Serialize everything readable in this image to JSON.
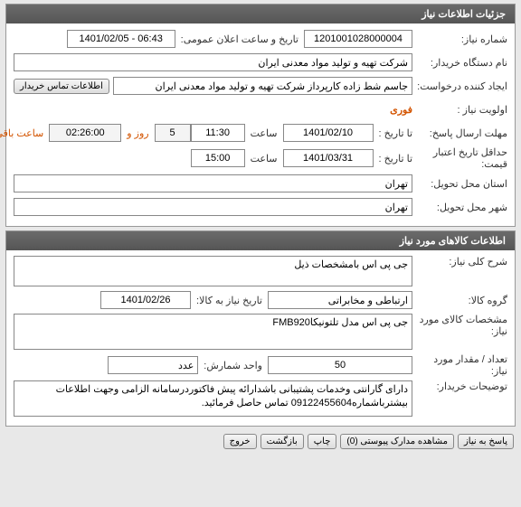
{
  "colors": {
    "accent": "#d35400"
  },
  "panels": {
    "need_header": "جزئیات اطلاعات نیاز",
    "goods_header": "اطلاعات کالاهای مورد نیاز"
  },
  "need": {
    "number_label": "شماره نیاز:",
    "number_value": "1201001028000004",
    "announce_label": "تاریخ و ساعت اعلان عمومی:",
    "announce_value": "1401/02/05 - 06:43",
    "buyer_label": "نام دستگاه خریدار:",
    "buyer_value": "شرکت تهیه و تولید مواد معدنی ایران",
    "creator_label": "ایجاد کننده درخواست:",
    "creator_value": "جاسم شط زاده کارپرداز شرکت تهیه و تولید مواد معدنی ایران",
    "contact_btn": "اطلاعات تماس خریدار",
    "priority_label": "اولویت نیاز :",
    "priority_value": "فوری",
    "reply_deadline_label": "مهلت ارسال پاسخ:",
    "to_date_label": "تا تاریخ :",
    "reply_date": "1401/02/10",
    "time_label": "ساعت",
    "reply_time": "11:30",
    "remain_days": "5",
    "remain_days_label": "روز و",
    "remain_time": "02:26:00",
    "remain_suffix": "ساعت باقی مانده",
    "price_validity_label": "حداقل تاریخ اعتبار قیمت:",
    "price_date": "1401/03/31",
    "price_time": "15:00",
    "delivery_province_label": "استان محل تحویل:",
    "delivery_province": "تهران",
    "delivery_city_label": "شهر محل تحویل:",
    "delivery_city": "تهران"
  },
  "goods": {
    "desc_label": "شرح کلی نیاز:",
    "desc_value": "جی پی اس بامشخصات ذیل",
    "group_label": "گروه کالا:",
    "group_value": "ارتباطی و مخابراتی",
    "need_date_label": "تاریخ نیاز به کالا:",
    "need_date_value": "1401/02/26",
    "spec_label": "مشخصات کالای مورد نیاز:",
    "spec_value": "جی پی اس مدل تلتونیکاFMB920",
    "amount_label": "تعداد / مقدار مورد نیاز:",
    "amount_value": "50",
    "unit_label": "واحد شمارش:",
    "unit_value": "عدد",
    "buyer_note_label": "توضیحات خریدار:",
    "buyer_note_value": "دارای گارانتی وخدمات پشتیبانی باشدارائه پیش فاکتوردرسامانه الزامی وجهت اطلاعات بیشترباشماره09122455604 تماس حاصل فرمائید."
  },
  "buttons": {
    "reply": "پاسخ به نیاز",
    "attach": "مشاهده مدارک پیوستی (0)",
    "print": "چاپ",
    "back": "بازگشت",
    "exit": "خروج"
  }
}
